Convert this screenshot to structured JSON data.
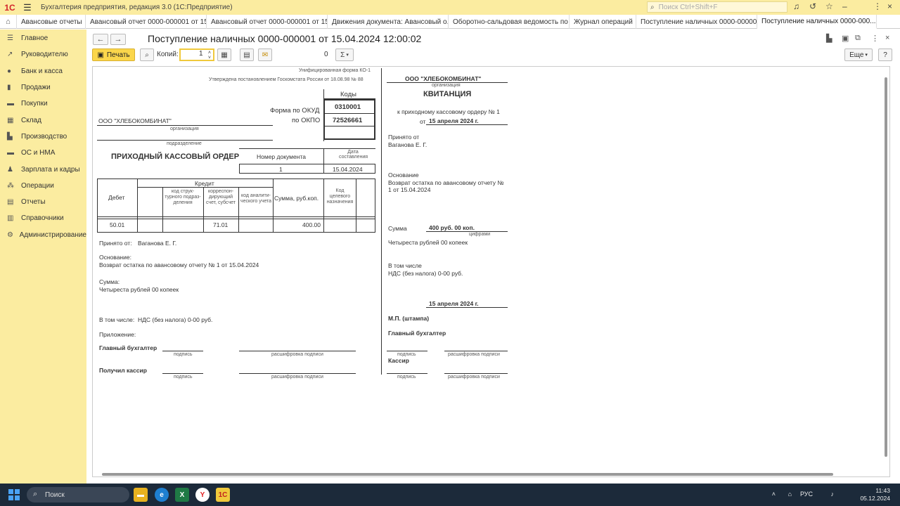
{
  "app": {
    "title": "Бухгалтерия предприятия, редакция 3.0 (1С:Предприятие)",
    "search_placeholder": "Поиск Ctrl+Shift+F"
  },
  "tabs": [
    {
      "label": "Авансовые отчеты"
    },
    {
      "label": "Авансовый отчет 0000-000001 от 15..."
    },
    {
      "label": "Авансовый отчет 0000-000001 от 15..."
    },
    {
      "label": "Движения документа: Авансовый о..."
    },
    {
      "label": "Оборотно-сальдовая ведомость по ..."
    },
    {
      "label": "Журнал операций"
    },
    {
      "label": "Поступление наличных 0000-000001"
    },
    {
      "label": "Поступление наличных 0000-000..."
    }
  ],
  "sidebar": {
    "items": [
      {
        "label": "Главное"
      },
      {
        "label": "Руководителю"
      },
      {
        "label": "Банк и касса"
      },
      {
        "label": "Продажи"
      },
      {
        "label": "Покупки"
      },
      {
        "label": "Склад"
      },
      {
        "label": "Производство"
      },
      {
        "label": "ОС и НМА"
      },
      {
        "label": "Зарплата и кадры"
      },
      {
        "label": "Операции"
      },
      {
        "label": "Отчеты"
      },
      {
        "label": "Справочники"
      },
      {
        "label": "Администрирование"
      }
    ]
  },
  "document": {
    "title": "Поступление наличных 0000-000001 от 15.04.2024 12:00:02"
  },
  "toolbar": {
    "print_label": "Печать",
    "copies_label": "Копий:",
    "copies_value": "1",
    "sum_value": "0",
    "sum_symbol": "Σ",
    "more_label": "Еще",
    "help_label": "?"
  },
  "form": {
    "unified_form": "Унифицированная форма КО-1",
    "approved": "Утверждена постановлением Госкомстата России от 18.08.98 № 88",
    "codes_header": "Коды",
    "okud_label": "Форма по ОКУД",
    "okud_value": "0310001",
    "okpo_label": "по ОКПО",
    "okpo_value": "72526661",
    "org_name": "ООО \"ХЛЕБОКОМБИНАТ\"",
    "org_caption": "организация",
    "division_caption": "подразделение",
    "order_title": "ПРИХОДНЫЙ КАССОВЫЙ ОРДЕР",
    "doc_number_header": "Номер документа",
    "doc_date_header": "Дата составления",
    "doc_number": "1",
    "doc_date": "15.04.2024",
    "table": {
      "debit": "Дебет",
      "credit": "Кредит",
      "col_division": "код струк-турного подраз-деления",
      "col_account": "корреспон-дирующий счет, субсчет",
      "col_analytics": "код аналити-ческого учета",
      "col_sum": "Сумма, руб.коп.",
      "col_purpose": "Код целевого назначения",
      "row_debit": "50.01",
      "row_account": "71.01",
      "row_sum": "400.00"
    },
    "received_from_label": "Принято от:",
    "received_from": "Ваганова Е. Г.",
    "basis_label": "Основание:",
    "basis": "Возврат остатка по авансовому отчету № 1 от 15.04.2024",
    "sum_label": "Сумма:",
    "sum_words": "Четыреста рублей 00 копеек",
    "incl_label": "В том числе:",
    "incl_value": "НДС (без налога) 0-00 руб.",
    "attachment_label": "Приложение:",
    "chief_accountant": "Главный бухгалтер",
    "cashier_received": "Получил кассир",
    "sign_caption": "подпись",
    "decode_caption": "расшифровка подписи"
  },
  "receipt": {
    "org_name": "ООО \"ХЛЕБОКОМБИНАТ\"",
    "org_caption": "организация",
    "title": "КВИТАНЦИЯ",
    "to_order": "к приходному кассовому ордеру № 1",
    "date_prefix": "от",
    "date": "15 апреля 2024 г.",
    "received_from_label": "Принято от",
    "received_from": "Ваганова Е. Г.",
    "basis_label": "Основание",
    "basis": "Возврат остатка по авансовому отчету № 1 от 15.04.2024",
    "sum_label": "Сумма",
    "sum_value": "400 руб. 00 коп.",
    "sum_caption": "цифрами",
    "sum_words": "Четыреста рублей 00 копеек",
    "incl_label": "В том числе",
    "incl_value": "НДС (без налога) 0-00 руб.",
    "date2": "15 апреля 2024 г.",
    "stamp": "М.П. (штампа)",
    "chief_accountant": "Главный бухгалтер",
    "cashier": "Кассир",
    "sign_caption": "подпись",
    "decode_caption": "расшифровка подписи"
  },
  "taskbar": {
    "search_label": "Поиск",
    "lang": "РУС",
    "time": "11:43",
    "date": "05.12.2024"
  }
}
